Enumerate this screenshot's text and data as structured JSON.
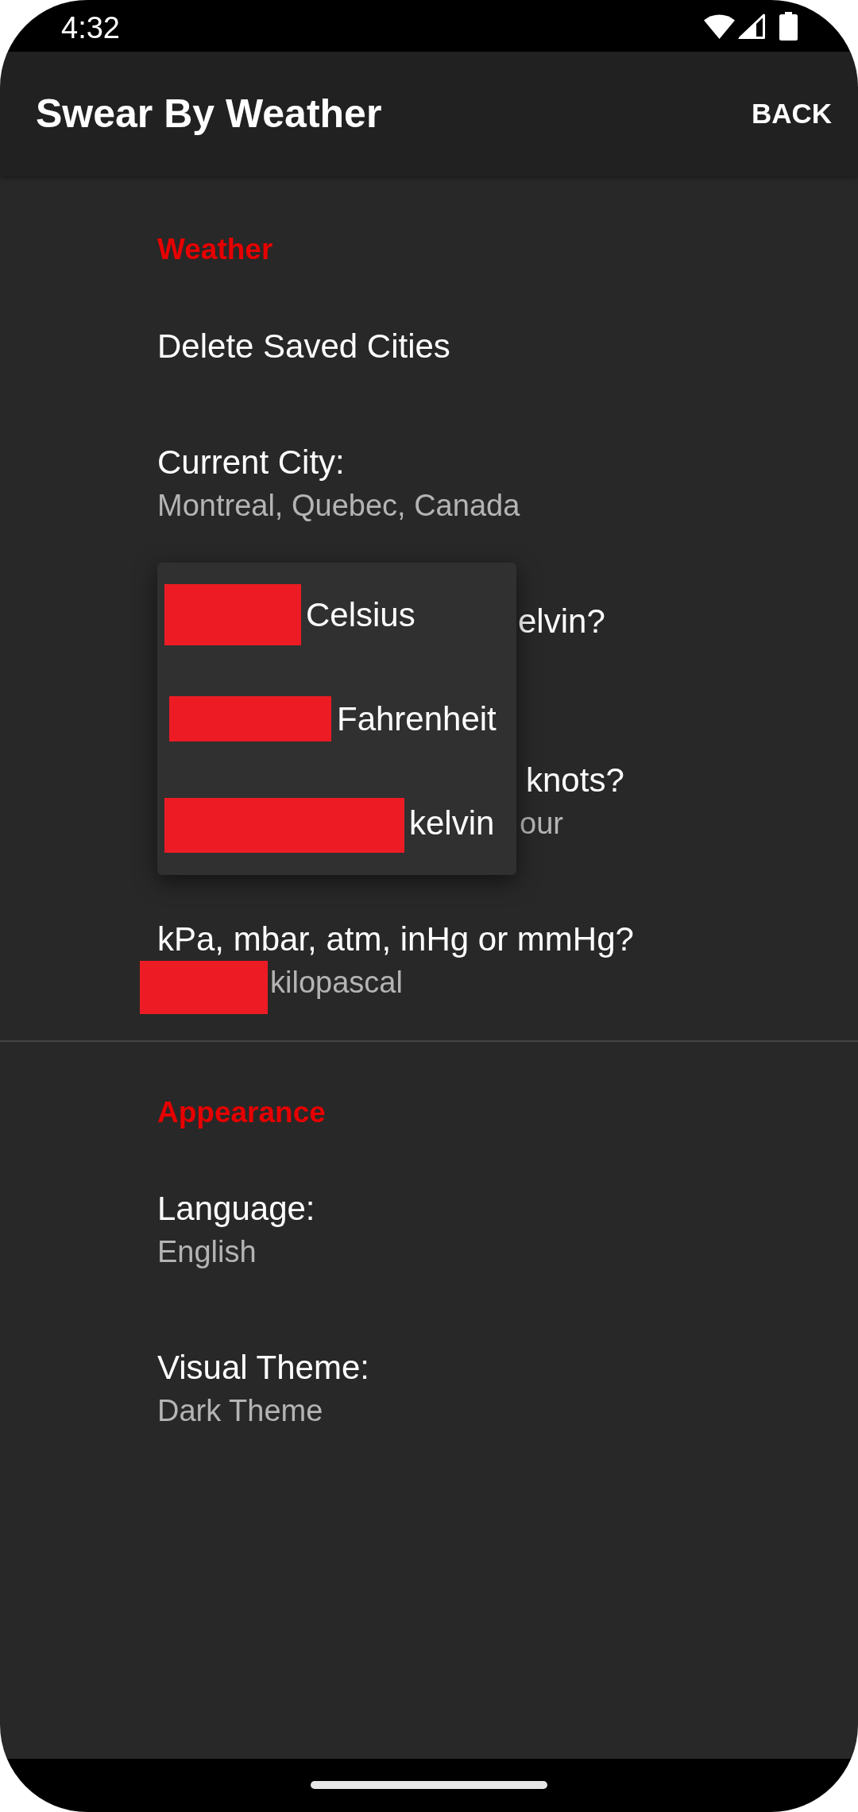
{
  "status_bar": {
    "time": "4:32"
  },
  "app_bar": {
    "title": "Swear By Weather",
    "action": "BACK"
  },
  "sections": [
    {
      "title": "Weather",
      "items": [
        {
          "kind": "action",
          "title": "Delete Saved Cities"
        },
        {
          "kind": "setting",
          "title": "Current City:",
          "summary": "Montreal, Quebec, Canada",
          "redacted": false
        },
        {
          "kind": "covered",
          "title": "elvin?"
        },
        {
          "kind": "covered",
          "title": "knots?",
          "summary": "our"
        },
        {
          "kind": "setting",
          "title": "kPa, mbar, atm, inHg or mmHg?",
          "summary": "kilopascal",
          "redacted": true
        }
      ]
    },
    {
      "title": "Appearance",
      "items": [
        {
          "kind": "setting",
          "title": "Language:",
          "summary": "English",
          "redacted": false
        },
        {
          "kind": "setting",
          "title": "Visual Theme:",
          "summary": "Dark Theme",
          "redacted": false
        }
      ]
    }
  ],
  "popup_menu": {
    "options": [
      {
        "label": "Celsius",
        "redacted": true
      },
      {
        "label": "Fahrenheit",
        "redacted": true
      },
      {
        "label": "kelvin",
        "redacted": true
      }
    ]
  }
}
